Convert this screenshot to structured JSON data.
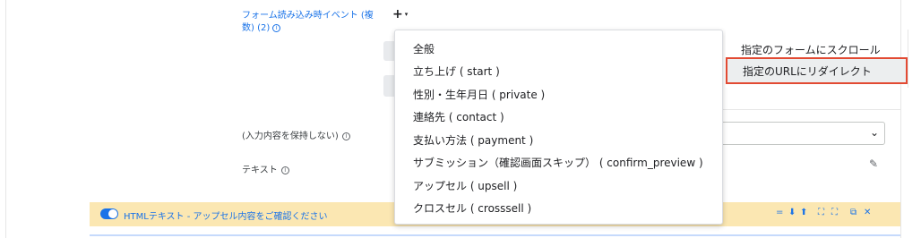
{
  "event_field": {
    "label": "フォーム読み込み時イベント (複数) (2)",
    "info_icon": "info-icon",
    "add_button": "+",
    "add_caret": "▾"
  },
  "hold_input": {
    "label": "(入力内容を保持しない)",
    "info_icon": "info-icon"
  },
  "text_field": {
    "label": "テキスト",
    "info_icon": "info-icon"
  },
  "html_bar": {
    "label": "HTMLテキスト - アップセル内容をご確認ください",
    "icons": [
      "=",
      "⬇",
      "⬆",
      "⛶",
      "⛶",
      "⧉",
      "✕"
    ]
  },
  "dropdown": {
    "items": [
      "全般",
      "立ち上げ ( start )",
      "性別・生年月日 ( private )",
      "連絡先 ( contact )",
      "支払い方法 ( payment )",
      "サブミッション（確認画面スキップ） ( confirm_preview )",
      "アップセル ( upsell )",
      "クロスセル ( crosssell )"
    ]
  },
  "side_menu": {
    "items": [
      "指定のフォームにスクロール",
      "指定のURLにリダイレクト"
    ],
    "selected_index": 1,
    "highlight_color": "#e24a33"
  },
  "colors": {
    "accent": "#1a73e8",
    "bar_bg": "#fbe7b2"
  }
}
